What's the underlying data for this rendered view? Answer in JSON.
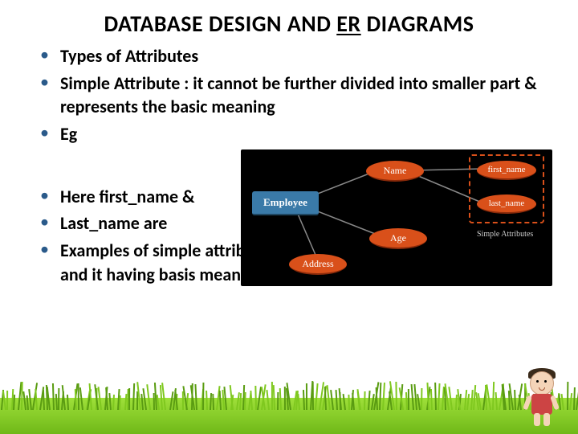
{
  "title_plain_1": "DATABASE DESIGN AND ",
  "title_u1": "ER",
  "title_plain_2": " DIAGRAMS",
  "bullets": {
    "b1": "Types of Attributes",
    "b2": "Simple Attribute : it cannot be further divided into smaller part & represents the basic meaning",
    "b3": "Eg",
    "b4": "Here first_name &",
    "b5": "Last_name are",
    "b6": "Examples of simple attributes, because it cannot be further divided and it having basis meaning"
  },
  "diagram": {
    "entity": "Employee",
    "attrs": {
      "name": "Name",
      "age": "Age",
      "address": "Address",
      "first_name": "first_name",
      "last_name": "last_name"
    },
    "box_label": "Simple Attributes"
  }
}
